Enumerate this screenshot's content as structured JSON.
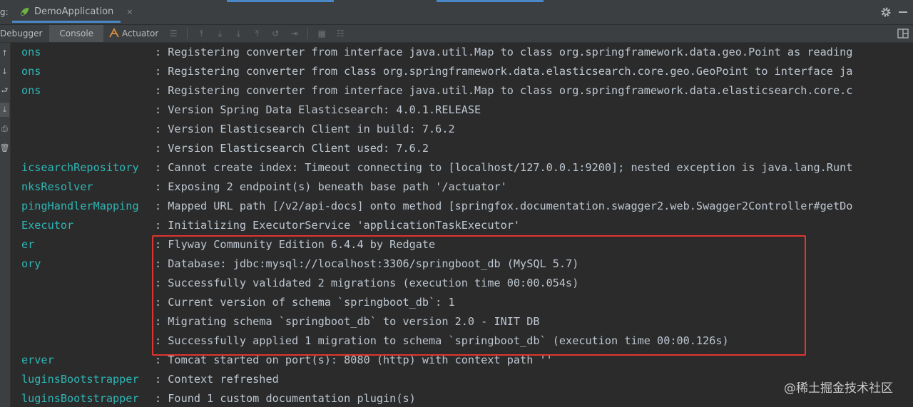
{
  "run_bar": {
    "prefix": "g:",
    "tab_label": "DemoApplication",
    "close": "×"
  },
  "toolbar": {
    "tabs": [
      "Debugger",
      "Console",
      "Actuator"
    ],
    "active_tab": "Console"
  },
  "console": {
    "lines": [
      {
        "logger": "ons",
        "message": ": Registering converter from interface java.util.Map to class org.springframework.data.geo.Point as reading"
      },
      {
        "logger": "ons",
        "message": ": Registering converter from class org.springframework.data.elasticsearch.core.geo.GeoPoint to interface ja"
      },
      {
        "logger": "ons",
        "message": ": Registering converter from interface java.util.Map to class org.springframework.data.elasticsearch.core.c"
      },
      {
        "logger": "",
        "message": ": Version Spring Data Elasticsearch: 4.0.1.RELEASE"
      },
      {
        "logger": "",
        "message": ": Version Elasticsearch Client in build: 7.6.2"
      },
      {
        "logger": "",
        "message": ": Version Elasticsearch Client used: 7.6.2"
      },
      {
        "logger": "icsearchRepository",
        "message": ": Cannot create index: Timeout connecting to [localhost/127.0.0.1:9200]; nested exception is java.lang.Runt"
      },
      {
        "logger": "nksResolver",
        "message": ": Exposing 2 endpoint(s) beneath base path '/actuator'"
      },
      {
        "logger": "pingHandlerMapping",
        "message": ": Mapped URL path [/v2/api-docs] onto method [springfox.documentation.swagger2.web.Swagger2Controller#getDo"
      },
      {
        "logger": "Executor",
        "message": ": Initializing ExecutorService 'applicationTaskExecutor'"
      },
      {
        "logger": "er",
        "message": ": Flyway Community Edition 6.4.4 by Redgate"
      },
      {
        "logger": "ory",
        "message": ": Database: jdbc:mysql://localhost:3306/springboot_db (MySQL 5.7)"
      },
      {
        "logger": "",
        "message": ": Successfully validated 2 migrations (execution time 00:00.054s)"
      },
      {
        "logger": "",
        "message": ": Current version of schema `springboot_db`: 1"
      },
      {
        "logger": "",
        "message": ": Migrating schema `springboot_db` to version 2.0 - INIT DB"
      },
      {
        "logger": "",
        "message": ": Successfully applied 1 migration to schema `springboot_db` (execution time 00:00.126s)"
      },
      {
        "logger": "erver",
        "message": ": Tomcat started on port(s): 8080 (http) with context path ''"
      },
      {
        "logger": "luginsBootstrapper",
        "message": ": Context refreshed"
      },
      {
        "logger": "luginsBootstrapper",
        "message": ": Found 1 custom documentation plugin(s)"
      }
    ]
  },
  "watermark": "@稀土掘金技术社区",
  "colors": {
    "logger": "#2fb5b5",
    "message": "#bdc6d0",
    "highlight": "#e0352f",
    "accent": "#4a88c7"
  }
}
